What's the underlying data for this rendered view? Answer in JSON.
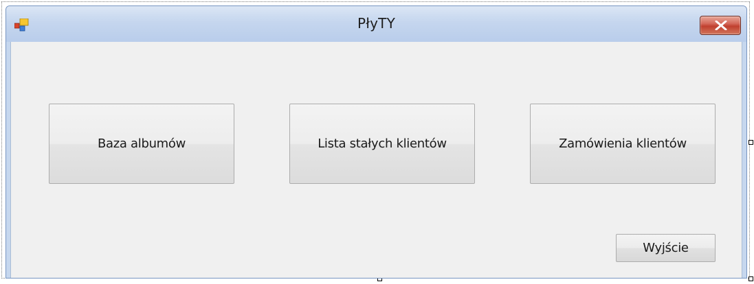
{
  "window": {
    "title": "PłyTY"
  },
  "icons": {
    "app": "application-icon",
    "close": "close-icon"
  },
  "buttons": {
    "albums_label": "Baza albumów",
    "regulars_label": "Lista stałych klientów",
    "orders_label": "Zamówienia klientów",
    "exit_label": "Wyjście"
  },
  "colors": {
    "title_bar": "#c5d6ee",
    "client_area": "#f0f0f0",
    "close_button": "#c0402f"
  }
}
